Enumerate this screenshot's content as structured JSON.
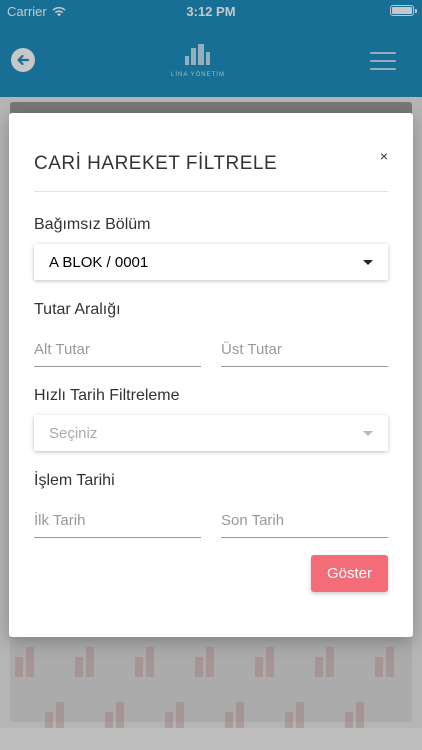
{
  "status_bar": {
    "carrier": "Carrier",
    "time": "3:12 PM"
  },
  "nav": {
    "logo_text": "LİNA YÖNETİM",
    "back_icon": "arrow-left-circle-icon",
    "menu_icon": "hamburger-menu-icon"
  },
  "modal": {
    "title": "CARİ HAREKET FİLTRELE",
    "close": "×",
    "unit_section": {
      "label": "Bağımsız Bölüm",
      "selected": "A BLOK / 0001"
    },
    "amount_section": {
      "label": "Tutar Aralığı",
      "min_placeholder": "Alt Tutar",
      "max_placeholder": "Üst Tutar"
    },
    "quick_date_section": {
      "label": "Hızlı Tarih Filtreleme",
      "placeholder": "Seçiniz"
    },
    "date_section": {
      "label": "İşlem Tarihi",
      "start_placeholder": "İlk Tarih",
      "end_placeholder": "Son Tarih"
    },
    "submit_label": "Göster"
  },
  "colors": {
    "nav_background": "#1f8fc0",
    "submit_button": "#f36c78"
  }
}
